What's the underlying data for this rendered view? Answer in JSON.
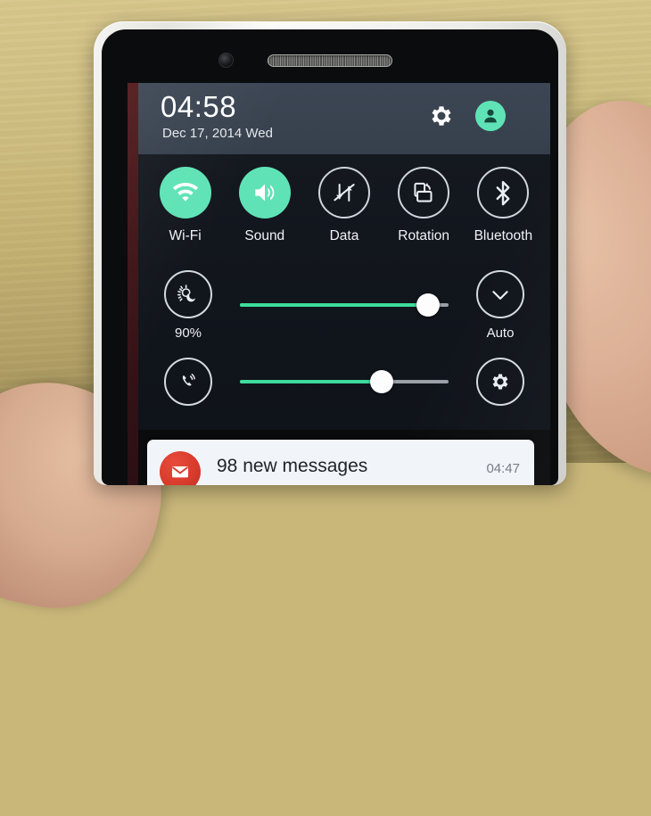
{
  "device": {
    "name": "LG G3 smartphone",
    "hardware": {
      "earpiece": "earpiece-speaker",
      "front_camera": "front-camera"
    }
  },
  "status_bar": {
    "time": "04:58",
    "date": "Dec 17, 2014 Wed",
    "settings_icon": "gear-icon",
    "profile_icon": "user-avatar-icon"
  },
  "quick_toggles": [
    {
      "label": "Wi-Fi",
      "icon": "wifi-icon",
      "state": "on"
    },
    {
      "label": "Sound",
      "icon": "speaker-icon",
      "state": "on"
    },
    {
      "label": "Data",
      "icon": "data-off-icon",
      "state": "off"
    },
    {
      "label": "Rotation",
      "icon": "rotation-icon",
      "state": "off"
    },
    {
      "label": "Bluetooth",
      "icon": "bluetooth-icon",
      "state": "off"
    }
  ],
  "brightness": {
    "icon": "brightness-sun-moon-icon",
    "value_label": "90%",
    "percent": 90,
    "auto_label": "Auto",
    "auto_icon": "checkmark-icon"
  },
  "volume": {
    "icon": "ringer-phone-icon",
    "percent": 68,
    "settings_icon": "gear-icon"
  },
  "notification": {
    "icon": "gmail-envelope-icon",
    "title": "98 new messages",
    "time": "04:47"
  },
  "colors": {
    "accent_green": "#5FE3B6",
    "slider_green": "#3DDC9C",
    "panel_dark": "#11151C",
    "header_dark": "#3A4450",
    "card_white": "#F1F4F8",
    "gmail_red": "#D93C2C"
  }
}
